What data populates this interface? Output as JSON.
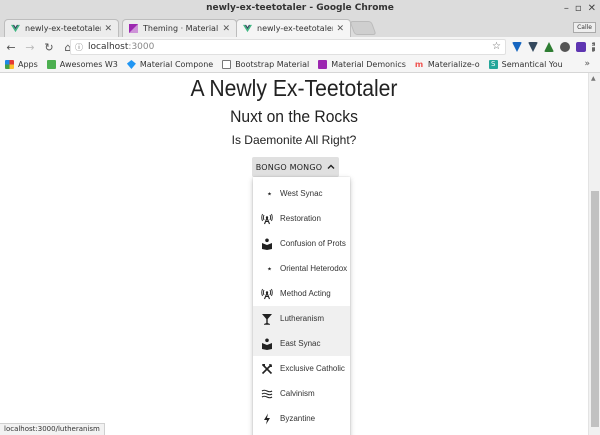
{
  "window": {
    "title": "newly-ex-teetotaler - Google Chrome",
    "user": "Calle"
  },
  "tabs": [
    {
      "title": "newly-ex-teetotaler",
      "favicon_color": "#41b883",
      "active": false
    },
    {
      "title": "Theming · Material",
      "favicon_color": "#9c27b0",
      "active": false
    },
    {
      "title": "newly-ex-teetotaler",
      "favicon_color": "#41b883",
      "active": true
    }
  ],
  "toolbar": {
    "url_host": "localhost",
    "url_port": ":3000",
    "extensions": [
      "#1565c0",
      "#35495e",
      "#2e7d32",
      "#555555",
      "#5e35b1",
      "#888888"
    ]
  },
  "bookmarks": [
    {
      "label": "Apps",
      "color": "#e53935"
    },
    {
      "label": "Awesomes W3",
      "color": "#4caf50"
    },
    {
      "label": "Material Compone",
      "color": "#2196f3"
    },
    {
      "label": "Bootstrap Material",
      "color": "#ffffff"
    },
    {
      "label": "Material Demonics",
      "color": "#9c27b0"
    },
    {
      "label": "Materialize-o",
      "color": "#ef5350"
    },
    {
      "label": "Semantical You",
      "color": "#26a69a"
    }
  ],
  "page": {
    "title": "A Newly Ex-Teetotaler",
    "subtitle": "Nuxt on the Rocks",
    "question": "Is Daemonite All Right?",
    "menu_button": "BONGO MONGO",
    "menu_items": [
      {
        "label": "West Synac",
        "icon": "star-crescent-icon",
        "highlighted": false
      },
      {
        "label": "Restoration",
        "icon": "antenna-icon",
        "highlighted": false
      },
      {
        "label": "Confusion of Prots",
        "icon": "book-reader-icon",
        "highlighted": false
      },
      {
        "label": "Oriental Heterodox",
        "icon": "star-crescent-icon",
        "highlighted": false
      },
      {
        "label": "Method Acting",
        "icon": "antenna-icon",
        "highlighted": false
      },
      {
        "label": "Lutheranism",
        "icon": "cocktail-glass-icon",
        "highlighted": true
      },
      {
        "label": "East Synac",
        "icon": "book-reader-icon",
        "highlighted": true
      },
      {
        "label": "Exclusive Catholic",
        "icon": "crossed-utensils-icon",
        "highlighted": false
      },
      {
        "label": "Calvinism",
        "icon": "waves-icon",
        "highlighted": false
      },
      {
        "label": "Byzantine",
        "icon": "lightning-icon",
        "highlighted": false
      }
    ]
  },
  "status_url": "localhost:3000/lutheranism"
}
